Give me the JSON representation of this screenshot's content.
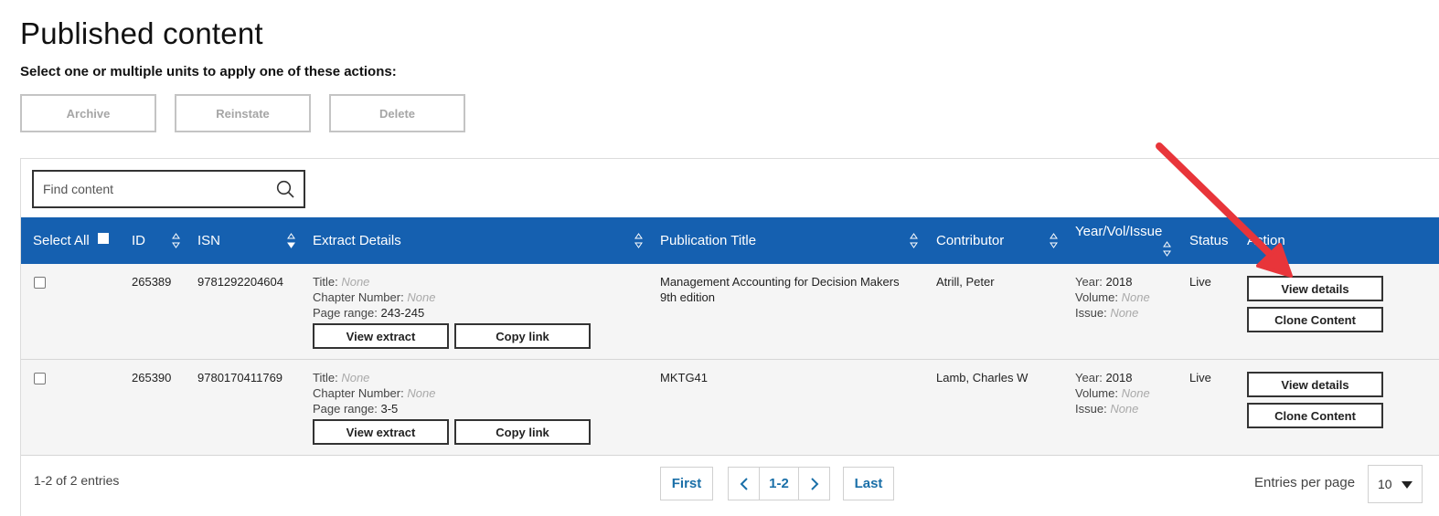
{
  "page": {
    "title": "Published content",
    "instructions": "Select one or multiple units to apply one of these actions:"
  },
  "bulk_actions": {
    "archive": "Archive",
    "reinstate": "Reinstate",
    "delete": "Delete"
  },
  "search": {
    "placeholder": "Find content"
  },
  "table": {
    "headers": {
      "select_all": "Select All",
      "id": "ID",
      "isn": "ISN",
      "extract_details": "Extract Details",
      "publication_title": "Publication Title",
      "contributor": "Contributor",
      "year_vol_issue": "Year/Vol/Issue",
      "status": "Status",
      "action": "Action"
    },
    "labels": {
      "title": "Title:",
      "chapter_number": "Chapter Number:",
      "page_range": "Page range:",
      "year": "Year:",
      "volume": "Volume:",
      "issue": "Issue:",
      "none": "None"
    },
    "buttons": {
      "view_extract": "View extract",
      "copy_link": "Copy link",
      "view_details": "View details",
      "clone_content": "Clone Content"
    },
    "rows": [
      {
        "id": "265389",
        "isn": "9781292204604",
        "page_range": "243-245",
        "publication_title_line1": "Management Accounting for Decision Makers",
        "publication_title_line2": "9th edition",
        "contributor": "Atrill, Peter",
        "year": "2018",
        "status": "Live"
      },
      {
        "id": "265390",
        "isn": "9780170411769",
        "page_range": "3-5",
        "publication_title_line1": "MKTG41",
        "publication_title_line2": "",
        "contributor": "Lamb, Charles W",
        "year": "2018",
        "status": "Live"
      }
    ]
  },
  "footer": {
    "entries_text": "1-2 of 2 entries",
    "first": "First",
    "page_range": "1-2",
    "last": "Last",
    "entries_per_page_label": "Entries per page",
    "entries_per_page_value": "10"
  },
  "colors": {
    "header_blue": "#1560b0",
    "link_blue": "#1a6fa8",
    "annotation_red": "#e8353a"
  },
  "icons": {
    "search": "search-icon",
    "sort": "sort-icon",
    "prev": "chevron-left-icon",
    "next": "chevron-right-icon",
    "dropdown": "caret-down-icon",
    "annotation": "red-arrow-annotation"
  }
}
